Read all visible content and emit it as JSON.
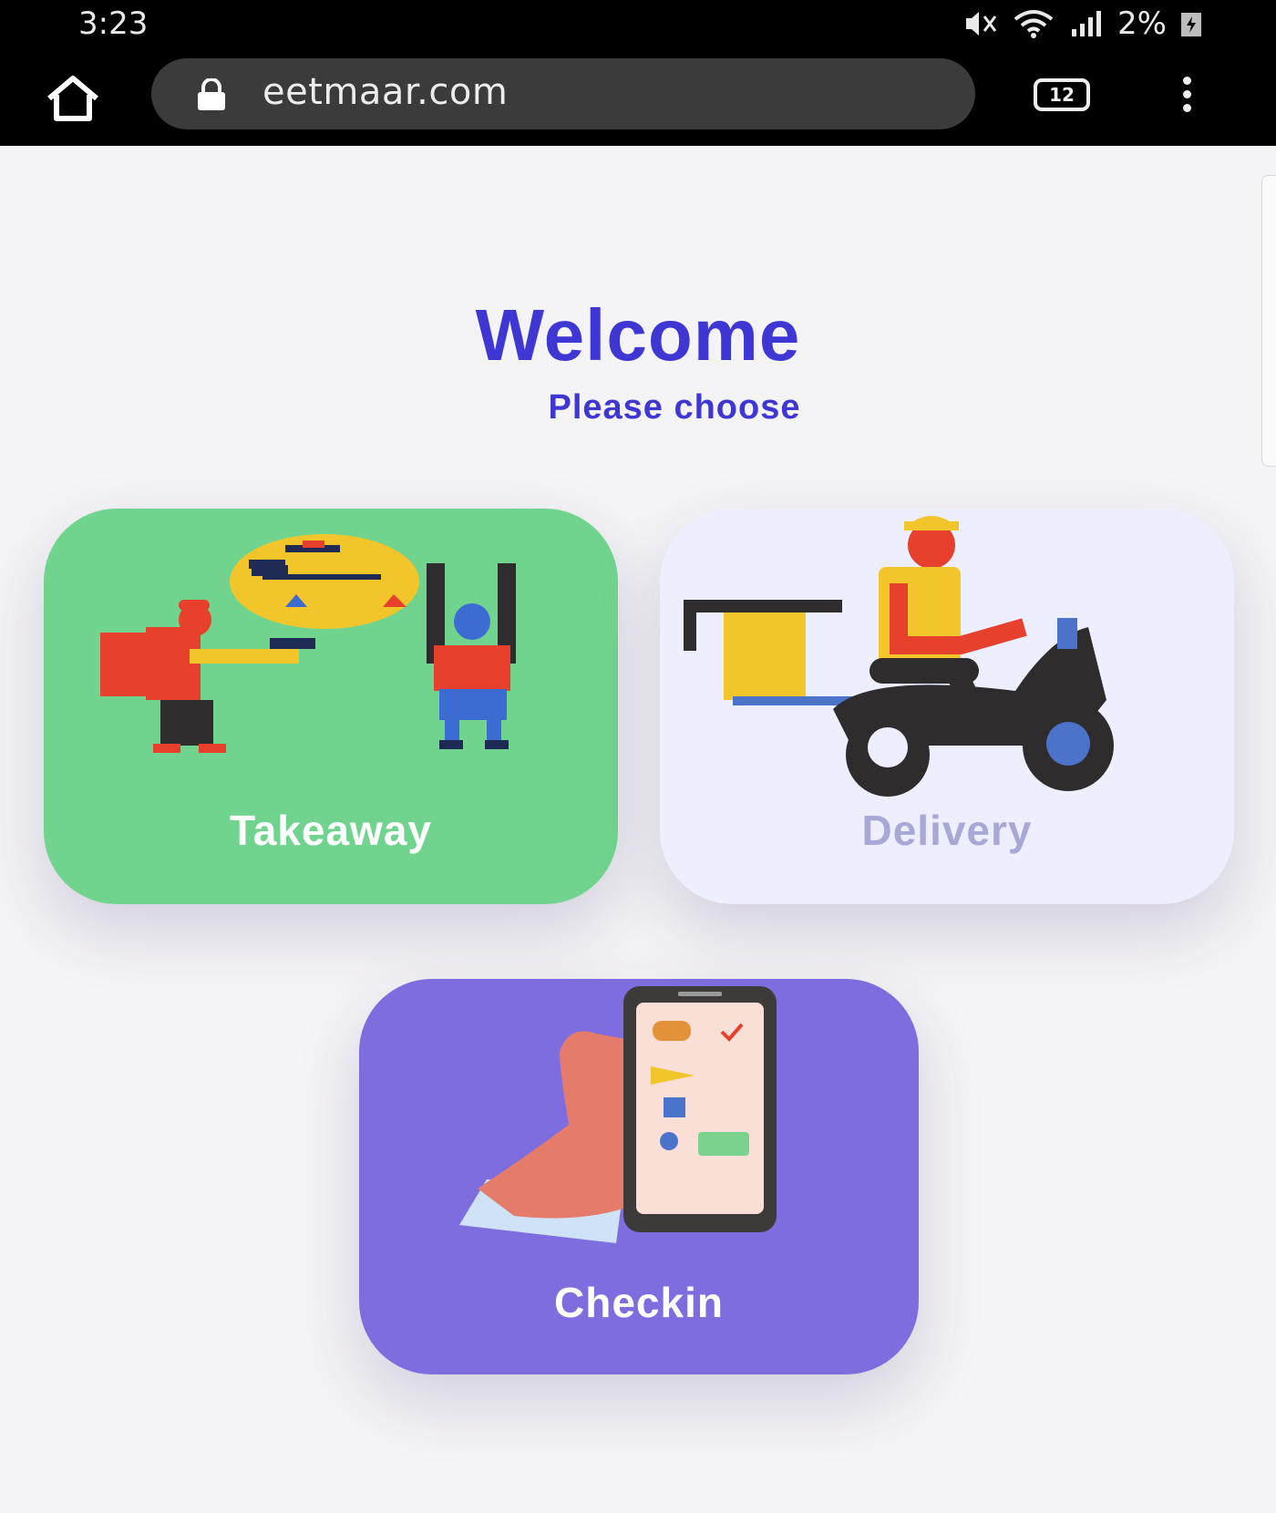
{
  "status_bar": {
    "time": "3:23",
    "battery": "2%",
    "icons": [
      "mute-icon",
      "wifi-icon",
      "signal-icon",
      "battery-charging-icon"
    ]
  },
  "browser": {
    "url": "eetmaar.com",
    "tab_count": "12",
    "icons": [
      "home-icon",
      "lock-icon",
      "tabs-icon",
      "menu-icon"
    ]
  },
  "page": {
    "title": "Welcome",
    "subtitle": "Please choose",
    "accent_color": "#3f37d4"
  },
  "options": [
    {
      "label": "Takeaway",
      "color": "#71d48e"
    },
    {
      "label": "Delivery",
      "color": "#eeeffe"
    },
    {
      "label": "Checkin",
      "color": "#7e6ddf"
    }
  ]
}
